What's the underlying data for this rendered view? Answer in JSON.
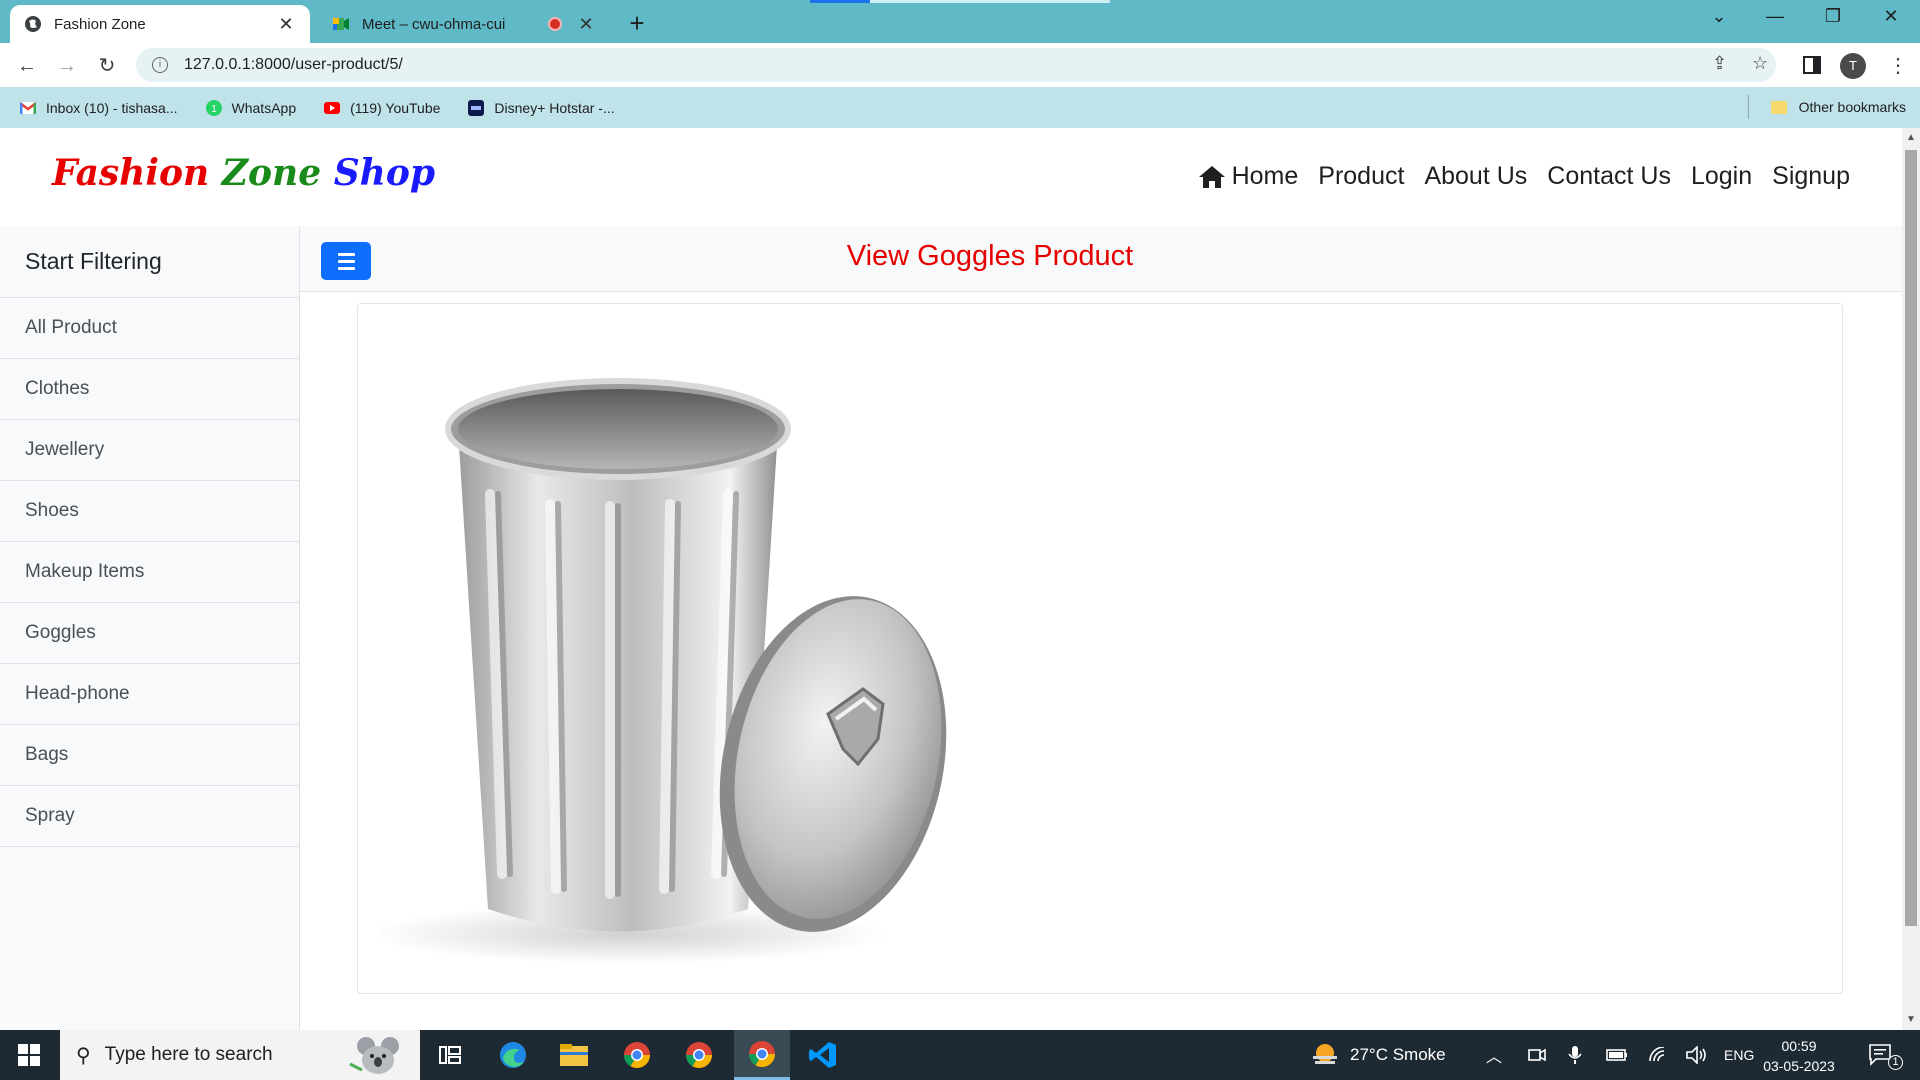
{
  "browser": {
    "tabs": [
      {
        "title": "Fashion Zone",
        "active": true
      },
      {
        "title": "Meet – cwu-ohma-cui",
        "active": false
      }
    ],
    "url": "127.0.0.1:8000/user-product/5/",
    "profile_initial": "T",
    "bookmarks": [
      {
        "label": "Inbox (10) - tishasa...",
        "icon": "gmail-icon"
      },
      {
        "label": "WhatsApp",
        "icon": "whatsapp-icon"
      },
      {
        "label": "(119) YouTube",
        "icon": "youtube-icon"
      },
      {
        "label": "Disney+ Hotstar -...",
        "icon": "hotstar-icon"
      }
    ],
    "other_bookmarks": "Other bookmarks"
  },
  "site": {
    "brand": {
      "w1": "Fashion",
      "w2": "Zone",
      "w3": "Shop"
    },
    "nav": {
      "home": "Home",
      "product": "Product",
      "about": "About Us",
      "contact": "Contact Us",
      "login": "Login",
      "signup": "Signup"
    }
  },
  "sidebar": {
    "heading": "Start Filtering",
    "items": [
      "All Product",
      "Clothes",
      "Jewellery",
      "Shoes",
      "Makeup Items",
      "Goggles",
      "Head-phone",
      "Bags",
      "Spray"
    ]
  },
  "main": {
    "title": "View Goggles Product",
    "product_image": "trash-can-icon"
  },
  "taskbar": {
    "search_placeholder": "Type here to search",
    "weather": "27°C  Smoke",
    "language": "ENG",
    "time": "00:59",
    "date": "03-05-2023",
    "notifications": "1"
  },
  "colors": {
    "tabbar": "#5fb9c7",
    "bookmarks_bar": "#bfe3e8",
    "brand_red": "#e60000",
    "brand_green": "#1a8a1a",
    "brand_blue": "#1a1aff",
    "title_red": "#e60000",
    "toggle_blue": "#0d6efd",
    "taskbar": "#1e2a33"
  }
}
